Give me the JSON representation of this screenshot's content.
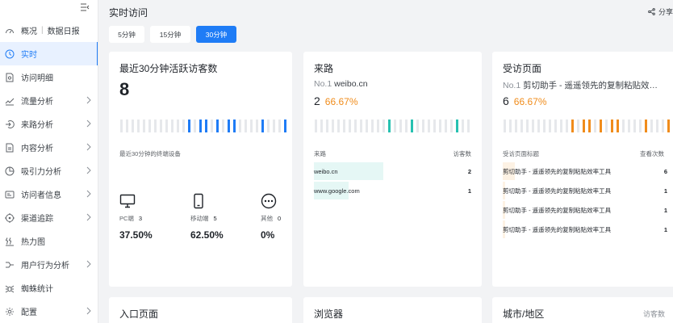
{
  "sidebar": {
    "items": [
      {
        "label": "概况",
        "label2": "数据日报",
        "icon": "dashboard-gauge-icon",
        "has_chevron": false
      },
      {
        "label": "实时",
        "icon": "clock-icon",
        "has_chevron": false,
        "active": true
      },
      {
        "label": "访问明细",
        "icon": "document-search-icon",
        "has_chevron": false
      },
      {
        "label": "流量分析",
        "icon": "trend-line-icon",
        "has_chevron": true
      },
      {
        "label": "来路分析",
        "icon": "enter-arrow-icon",
        "has_chevron": true
      },
      {
        "label": "内容分析",
        "icon": "file-icon",
        "has_chevron": true
      },
      {
        "label": "吸引力分析",
        "icon": "pie-icon",
        "has_chevron": true
      },
      {
        "label": "访问者信息",
        "icon": "id-card-icon",
        "has_chevron": true
      },
      {
        "label": "渠道追踪",
        "icon": "target-icon",
        "has_chevron": true
      },
      {
        "label": "热力图",
        "icon": "heatmap-grid-icon",
        "has_chevron": false
      },
      {
        "label": "用户行为分析",
        "icon": "flow-icon",
        "has_chevron": true
      },
      {
        "label": "蜘蛛统计",
        "icon": "spider-icon",
        "has_chevron": false
      },
      {
        "label": "配置",
        "icon": "gear-icon",
        "has_chevron": true
      }
    ]
  },
  "header": {
    "title": "实时访问",
    "share": "分享"
  },
  "tabs": [
    {
      "label": "5分钟",
      "active": false
    },
    {
      "label": "15分钟",
      "active": false
    },
    {
      "label": "30分钟",
      "active": true
    }
  ],
  "active_card": {
    "title": "最近30分钟活跃访客数",
    "count": "8",
    "note": "最近30分钟的终端设备",
    "devices": [
      {
        "name": "PC端",
        "count": "3",
        "pct": "37.50%",
        "icon": "monitor-icon"
      },
      {
        "name": "移动端",
        "count": "5",
        "pct": "62.50%",
        "icon": "mobile-phone-icon"
      },
      {
        "name": "其他",
        "count": "0",
        "pct": "0%",
        "icon": "more-circle-icon"
      }
    ]
  },
  "referrer_card": {
    "title": "来路",
    "rank": "No.1",
    "top": "weibo.cn",
    "count": "2",
    "pct": "66.67%",
    "col_name": "来路",
    "col_value": "访客数",
    "rows": [
      {
        "name": "weibo.cn",
        "value": "2",
        "share": 0.6667
      },
      {
        "name": "www.google.com",
        "value": "1",
        "share": 0.3333
      }
    ]
  },
  "landing_card": {
    "title": "受访页面",
    "rank": "No.1",
    "top": "剪切助手 - 遥遥领先的复制粘贴效率工具",
    "count": "6",
    "pct": "66.67%",
    "col_name": "受访页面标题",
    "col_value": "查看次数",
    "rows": [
      {
        "name": "剪切助手 - 遥遥领先的复制粘贴效率工具",
        "value": "6",
        "share": 0.6667
      },
      {
        "name": "剪切助手 - 遥遥领先的复制粘贴效率工具",
        "value": "1",
        "share": 0.1111
      },
      {
        "name": "剪切助手 - 遥遥领先的复制粘贴效率工具",
        "value": "1",
        "share": 0.1111
      },
      {
        "name": "剪切助手 - 遥遥领先的复制粘贴效率工具",
        "value": "1",
        "share": 0.1111
      }
    ]
  },
  "bottom_cards": [
    {
      "title": "入口页面"
    },
    {
      "title": "浏览器"
    },
    {
      "title": "城市/地区",
      "right_label": "访客数"
    }
  ],
  "colors": {
    "accent": "#1f7cf6",
    "teal": "#27c1b1",
    "orange": "#f08c1b",
    "highlight_teal": "#e5f7f5",
    "highlight_orange": "#fdf2e4"
  },
  "spark_active": [
    0,
    0,
    0,
    0,
    0,
    0,
    0,
    0,
    0,
    0,
    0,
    0,
    1,
    0,
    1,
    1,
    0,
    1,
    0,
    1,
    1,
    0,
    0,
    0,
    0,
    1,
    0,
    0,
    0,
    1
  ],
  "spark_referrer": [
    0,
    0,
    0,
    0,
    0,
    0,
    0,
    0,
    0,
    0,
    0,
    0,
    0,
    1,
    0,
    0,
    0,
    1,
    0,
    0,
    0,
    0,
    0,
    0,
    0,
    1,
    0,
    0
  ],
  "spark_landing": [
    0,
    0,
    0,
    0,
    0,
    0,
    0,
    0,
    0,
    0,
    0,
    0,
    1,
    0,
    1,
    1,
    0,
    1,
    0,
    1,
    1,
    0,
    0,
    0,
    0,
    1,
    0,
    0,
    0,
    1
  ]
}
